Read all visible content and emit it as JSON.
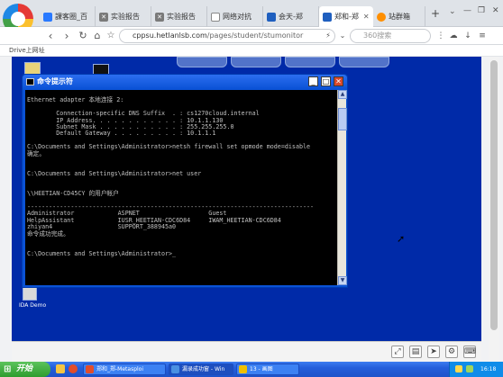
{
  "browser": {
    "tabs": [
      {
        "label": "課客圈_百",
        "icon": "blue-square-icon"
      },
      {
        "label": "实验报告",
        "icon": "tools-icon"
      },
      {
        "label": "实验报告",
        "icon": "tools-icon"
      },
      {
        "label": "网络对抗",
        "icon": "page-icon"
      },
      {
        "label": "会天-郑",
        "icon": "shield-icon"
      },
      {
        "label": "郑和-郑",
        "icon": "shield-icon"
      },
      {
        "label": "站群箱",
        "icon": "globe-icon"
      }
    ],
    "new_tab_label": "+",
    "url_prefix": "cppsu.hetlanlsb.com",
    "url_path": "/pages/student/stumonitor",
    "search_placeholder": "360搜索",
    "bookmark": "Drive上网址"
  },
  "remote": {
    "top_pills": [
      "",
      "",
      "",
      ""
    ],
    "desktop_icons": [
      {
        "label": "",
        "name": "my-documents"
      },
      {
        "label": "",
        "name": "my-computer"
      }
    ],
    "bottom_icon_label": "IDA Demo",
    "cmd": {
      "title": "命令提示符",
      "lines": [
        "",
        "Ethernet adapter 本地连接 2:",
        "",
        "        Connection-specific DNS Suffix  . : cs1270cloud.internal",
        "        IP Address. . . . . . . . . . . . : 10.1.1.130",
        "        Subnet Mask . . . . . . . . . . . : 255.255.255.0",
        "        Default Gateway . . . . . . . . . : 10.1.1.1",
        "",
        "C:\\Documents and Settings\\Administrator>netsh firewall set opmode mode=disable",
        "确定。",
        "",
        "",
        "C:\\Documents and Settings\\Administrator>net user",
        "",
        "",
        "\\\\HEETIAN-CD45CY 的用户帐户",
        "",
        "-------------------------------------------------------------------------------",
        "Administrator            ASPNET                   Guest",
        "HelpAssistant            IUSR_HEETIAN-CDC6D84     IWAM_HEETIAN-CDC6D84",
        "zhiyan4                  SUPPORT_388945a0",
        "命令成功完成。",
        "",
        "",
        "C:\\Documents and Settings\\Administrator>_"
      ]
    }
  },
  "taskbar": {
    "start_label": "开始",
    "items": [
      {
        "label": ""
      },
      {
        "label": "郑和_郑-Metasploi"
      },
      {
        "label": "漏录成功窗 - Win"
      },
      {
        "label": "13 - 画图"
      }
    ],
    "clock": "16:18"
  }
}
